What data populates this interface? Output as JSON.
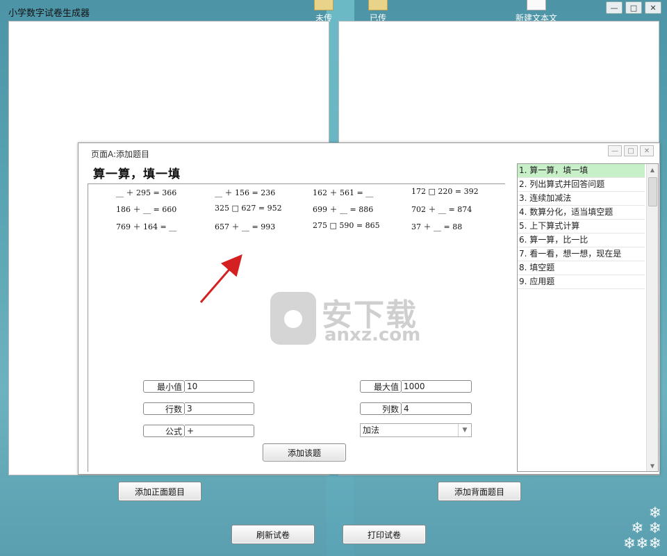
{
  "app": {
    "title": "小学数字试卷生成器"
  },
  "window_controls": {
    "minimize": "—",
    "maximize": "□",
    "close": "✕"
  },
  "desktop_icons": [
    {
      "label": "未传"
    },
    {
      "label": "已传"
    },
    {
      "label": "新建文本文"
    }
  ],
  "buttons": {
    "add_front": "添加正面题目",
    "add_back": "添加背面题目",
    "refresh": "刷新试卷",
    "print": "打印试卷"
  },
  "dialog": {
    "title": "页面A:添加题目",
    "section_title": "算一算，填一填",
    "equations": [
      [
        "__ ＋ 295 = 366",
        "__ ＋ 156 = 236",
        "162 ＋ 561 = __",
        "172 □ 220 = 392"
      ],
      [
        "186 ＋ __ = 660",
        "325 □ 627 = 952",
        "699 ＋ __ = 886",
        "702 ＋ __ = 874"
      ],
      [
        "769 ＋ 164 = __",
        "657 ＋ __ = 993",
        "275 □ 590 = 865",
        "37 ＋ __ = 88"
      ]
    ],
    "fields": {
      "min_label": "最小值",
      "min_value": "10",
      "max_label": "最大值",
      "max_value": "1000",
      "rows_label": "行数",
      "rows_value": "3",
      "cols_label": "列数",
      "cols_value": "4",
      "formula_label": "公式",
      "formula_value": "+",
      "operation_selected": "加法"
    },
    "add_button": "添加该题",
    "question_types": [
      "1. 算一算，填一填",
      "2. 列出算式并回答问题",
      "3. 连续加减法",
      "4. 数算分化，适当填空题",
      "5. 上下算式计算",
      "6. 算一算，比一比",
      "7. 看一看，想一想，现在是",
      "8. 填空题",
      "9. 应用题"
    ],
    "selected_index": 0
  },
  "watermark": {
    "cn": "安下载",
    "en": "anxz.com"
  },
  "colors": {
    "selected_item": "#c8f0c8",
    "arrow": "#d42020"
  }
}
